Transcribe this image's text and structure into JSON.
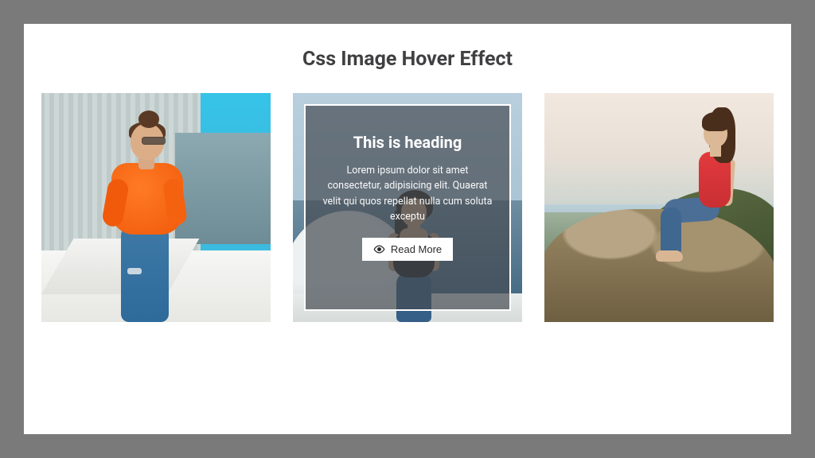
{
  "page": {
    "title": "Css Image Hover Effect"
  },
  "cards": [
    {
      "alt": "woman-orange-shirt-rooftop"
    },
    {
      "alt": "woman-black-top-seaside",
      "overlay": {
        "heading": "This is heading",
        "text": "Lorem ipsum dolor sit amet consectetur, adipisicing elit. Quaerat velit qui quos repellat nulla cum soluta exceptu",
        "button_label": "Read More"
      }
    },
    {
      "alt": "woman-red-top-on-rock-coast"
    }
  ]
}
